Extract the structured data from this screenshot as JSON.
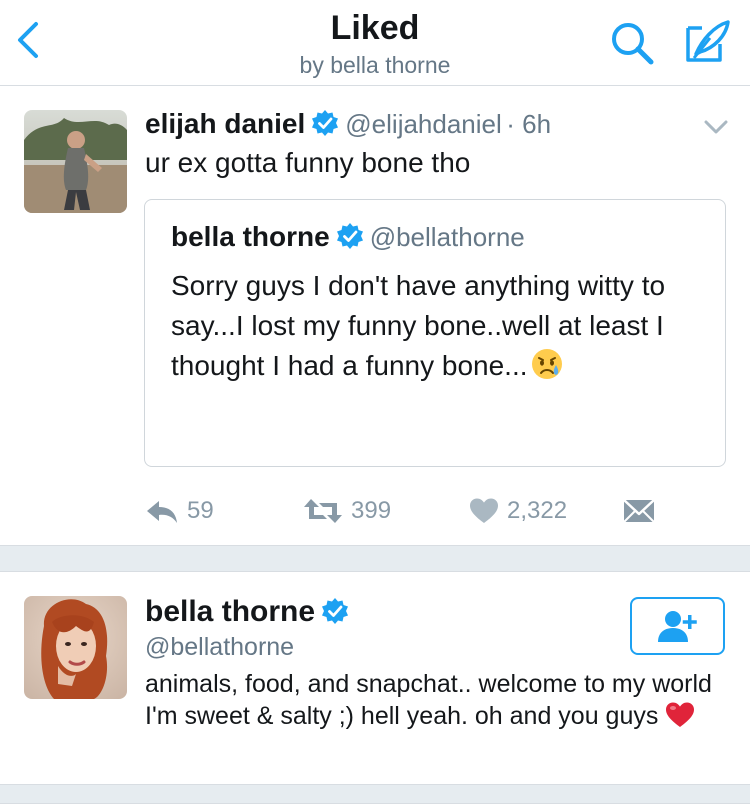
{
  "header": {
    "title": "Liked",
    "subtitle": "by bella thorne",
    "back_icon": "chevron-left-icon",
    "search_icon": "search-icon",
    "compose_icon": "compose-feather-icon"
  },
  "colors": {
    "accent": "#1da1f2",
    "text_primary": "#14171a",
    "text_secondary": "#657786",
    "action_gray": "#8899a6",
    "divider_bg": "#e6ecf0",
    "heart_emoji": "#e0243a"
  },
  "tweet": {
    "author_name": "elijah daniel",
    "author_handle": "@elijahdaniel",
    "time": "· 6h",
    "text": "ur ex gotta funny bone tho",
    "quoted": {
      "author_name": "bella thorne",
      "author_handle": "@bellathorne",
      "text": "Sorry guys I don't have anything witty to say...I lost my funny bone..well at least I thought I had a funny bone..."
    },
    "actions": {
      "replies": "59",
      "retweets": "399",
      "likes": "2,322"
    }
  },
  "profile": {
    "name": "bella thorne",
    "handle": "@bellathorne",
    "bio": "animals, food, and snapchat.. welcome to my world I'm sweet & salty ;) hell yeah. oh and you guys"
  }
}
